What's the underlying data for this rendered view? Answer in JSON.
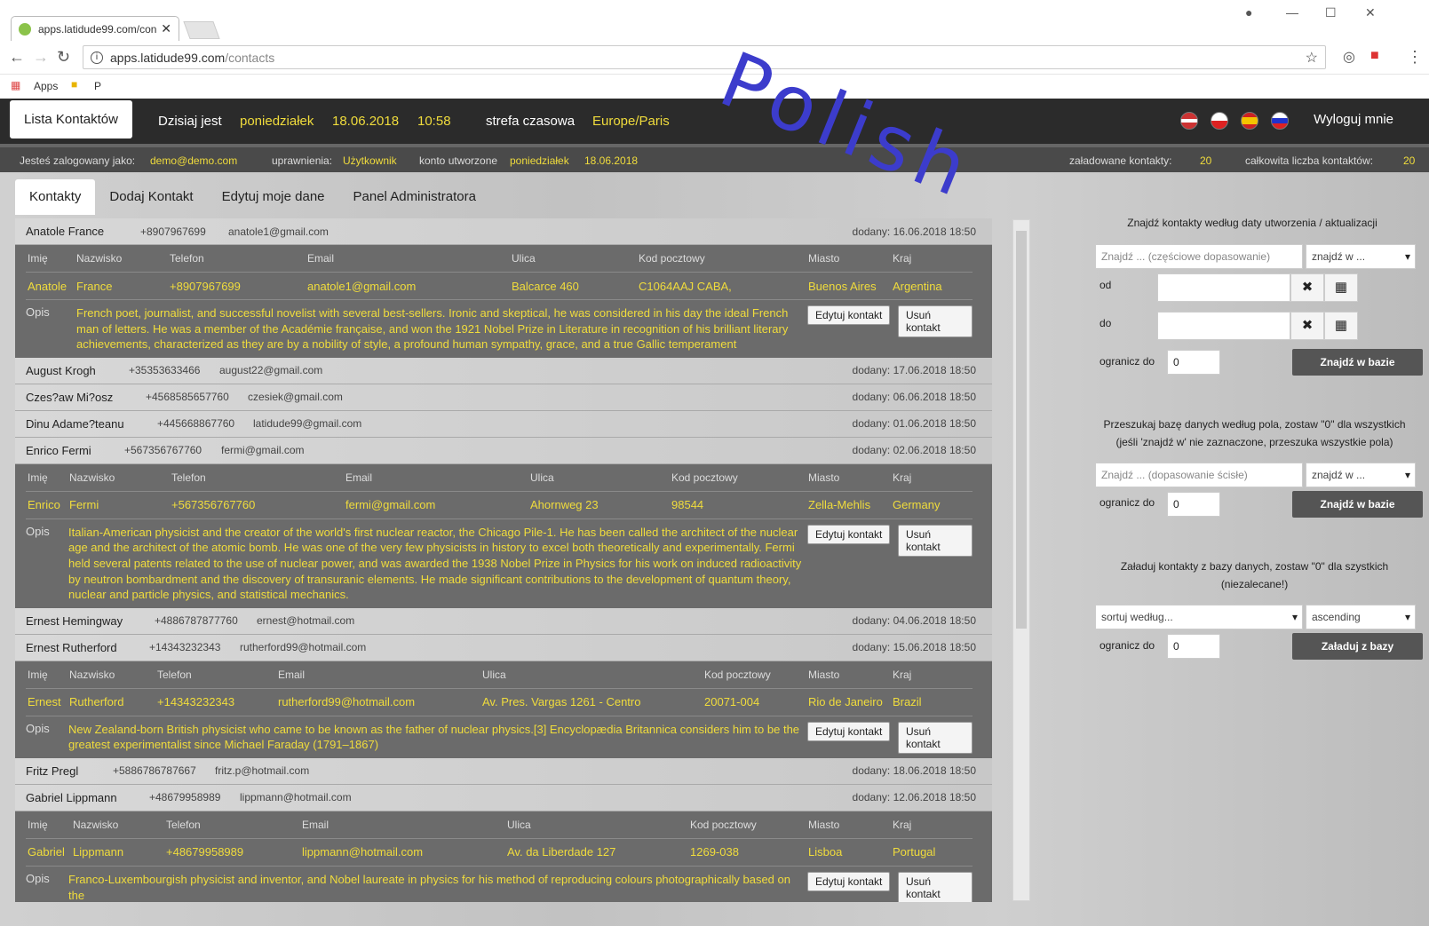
{
  "browser": {
    "tab_title": "apps.latidude99.com/con",
    "url_host": "apps.latidude99.com",
    "url_path": "/contacts",
    "bookmarks": [
      "Apps",
      "P"
    ]
  },
  "watermark": "Polish",
  "header": {
    "brand": "Lista Kontaktów",
    "today_label": "Dzisiaj jest",
    "day": "poniedziałek",
    "date": "18.06.2018",
    "time": "10:58",
    "tz_label": "strefa czasowa",
    "tz": "Europe/Paris",
    "logout": "Wyloguj mnie"
  },
  "infobar": {
    "logged_label": "Jesteś zalogowany jako:",
    "email": "demo@demo.com",
    "perm_label": "uprawnienia:",
    "perm": "Użytkownik",
    "created_label": "konto utworzone",
    "created_day": "poniedziałek",
    "created_date": "18.06.2018",
    "loaded_label": "załadowane kontakty:",
    "loaded": "20",
    "total_label": "całkowita liczba kontaktów:",
    "total": "20"
  },
  "tabs": [
    "Kontakty",
    "Dodaj Kontakt",
    "Edytuj moje dane",
    "Panel Administratora"
  ],
  "labels": {
    "imie": "Imię",
    "nazwisko": "Nazwisko",
    "telefon": "Telefon",
    "email": "Email",
    "ulica": "Ulica",
    "kod": "Kod pocztowy",
    "miasto": "Miasto",
    "kraj": "Kraj",
    "opis": "Opis",
    "edit": "Edytuj kontakt",
    "delete": "Usuń kontakt"
  },
  "contacts": [
    {
      "name": "Anatole France",
      "phone": "+8907967699",
      "email": "anatole1@gmail.com",
      "added": "dodany: 16.06.2018 18:50",
      "first": "Anatole",
      "last": "France",
      "street": "Balcarce 460",
      "zip": "C1064AAJ CABA,",
      "city": "Buenos Aires",
      "country": "Argentina",
      "desc": "French poet, journalist, and successful novelist with several best-sellers. Ironic and skeptical, he was considered in his day the ideal French man of letters. He was a member of the Académie française, and won the 1921 Nobel Prize in Literature in recognition of his brilliant literary achievements, characterized as they are by a nobility of style, a profound human sympathy, grace, and a true Gallic temperament"
    },
    {
      "name": "August Krogh",
      "phone": "+35353633466",
      "email": "august22@gmail.com",
      "added": "dodany: 17.06.2018 18:50"
    },
    {
      "name": "Czes?aw Mi?osz",
      "phone": "+4568585657760",
      "email": "czesiek@gmail.com",
      "added": "dodany: 06.06.2018 18:50"
    },
    {
      "name": "Dinu Adame?teanu",
      "phone": "+445668867760",
      "email": "latidude99@gmail.com",
      "added": "dodany: 01.06.2018 18:50"
    },
    {
      "name": "Enrico Fermi",
      "phone": "+567356767760",
      "email": "fermi@gmail.com",
      "added": "dodany: 02.06.2018 18:50",
      "first": "Enrico",
      "last": "Fermi",
      "street": "Ahornweg 23",
      "zip": "98544",
      "city": "Zella-Mehlis",
      "country": "Germany",
      "desc": "Italian-American physicist and the creator of the world's first nuclear reactor, the Chicago Pile-1. He has been called the architect of the nuclear age and the architect of the atomic bomb. He was one of the very few physicists in history to excel both theoretically and experimentally. Fermi held several patents related to the use of nuclear power, and was awarded the 1938 Nobel Prize in Physics for his work on induced radioactivity by neutron bombardment and the discovery of transuranic elements. He made significant contributions to the development of quantum theory, nuclear and particle physics, and statistical mechanics."
    },
    {
      "name": "Ernest Hemingway",
      "phone": "+4886787877760",
      "email": "ernest@hotmail.com",
      "added": "dodany: 04.06.2018 18:50"
    },
    {
      "name": "Ernest Rutherford",
      "phone": "+14343232343",
      "email": "rutherford99@hotmail.com",
      "added": "dodany: 15.06.2018 18:50",
      "first": "Ernest",
      "last": "Rutherford",
      "street": "Av. Pres. Vargas 1261 - Centro",
      "zip": "20071-004",
      "city": "Rio de Janeiro",
      "country": "Brazil",
      "desc": "New Zealand-born British physicist who came to be known as the father of nuclear physics.[3] Encyclopædia Britannica considers him to be the greatest experimentalist since Michael Faraday (1791–1867)"
    },
    {
      "name": "Fritz Pregl",
      "phone": "+5886786787667",
      "email": "fritz.p@hotmail.com",
      "added": "dodany: 18.06.2018 18:50"
    },
    {
      "name": "Gabriel Lippmann",
      "phone": "+48679958989",
      "email": "lippmann@hotmail.com",
      "added": "dodany: 12.06.2018 18:50",
      "first": "Gabriel",
      "last": "Lippmann",
      "street": "Av. da Liberdade 127",
      "zip": "1269-038",
      "city": "Lisboa",
      "country": "Portugal",
      "desc": "Franco-Luxembourgish physicist and inventor, and Nobel laureate in physics for his method of reproducing colours photographically based on the"
    }
  ],
  "panel": {
    "date_title": "Znajdź kontakty według daty utworzenia / aktualizacji",
    "date_search_placeholder": "Znajdź ... (częściowe dopasowanie)",
    "find_in": "znajdź w ...",
    "from": "od",
    "to": "do",
    "limit": "ogranicz do",
    "limit_value": "0",
    "find_db": "Znajdź w bazie",
    "field_title": "Przeszukaj bazę danych według pola, zostaw \"0\" dla wszystkich",
    "field_title2": "(jeśli 'znajdź w' nie zaznaczone, przeszuka wszystkie pola)",
    "field_search_placeholder": "Znajdź ... (dopasowanie ścisłe)",
    "load_title": "Załaduj kontakty z bazy danych, zostaw \"0\" dla szystkich",
    "load_title2": "(niezalecane!)",
    "sort_by": "sortuj według...",
    "order": "ascending",
    "load_db": "Załaduj z bazy"
  },
  "colors": {
    "accent": "#f0dc3c",
    "header_bg": "#2b2b2b",
    "detail_bg": "#6b6b6b",
    "watermark": "#3c3ccc"
  }
}
